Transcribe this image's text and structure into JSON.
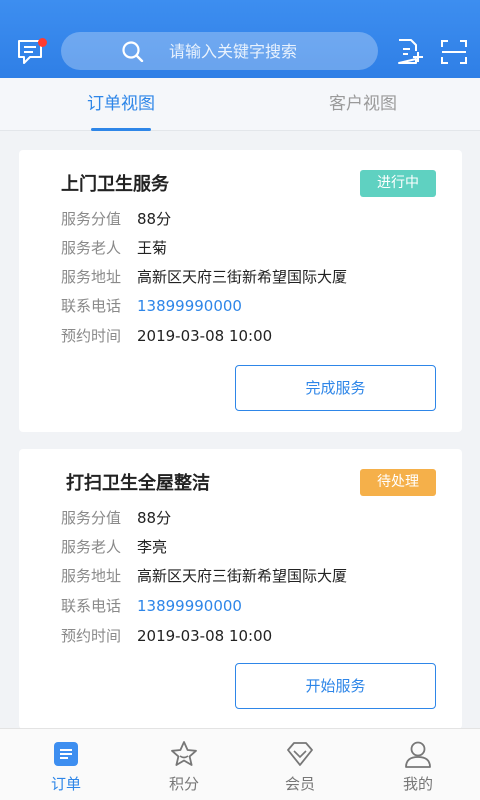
{
  "header": {
    "search_placeholder": "请输入关键字搜索",
    "icons": [
      "message-icon",
      "search-icon",
      "add-document-icon",
      "scan-icon"
    ],
    "accent": "#2e86e8"
  },
  "tabs": [
    {
      "label": "订单视图",
      "active": true
    },
    {
      "label": "客户视图",
      "active": false
    }
  ],
  "orders": [
    {
      "title": "上门卫生服务",
      "status": "进行中",
      "status_color": "#5fd1c1",
      "fields": [
        {
          "label": "服务分值",
          "value": "88分"
        },
        {
          "label": "服务老人",
          "value": "王菊"
        },
        {
          "label": "服务地址",
          "value": "高新区天府三街新希望国际大厦"
        },
        {
          "label": "联系电话",
          "value": "13899990000"
        },
        {
          "label": "预约时间",
          "value": "2019-03-08 10:00"
        }
      ],
      "action": "完成服务"
    },
    {
      "title": "打扫卫生全屋整洁",
      "status": "待处理",
      "status_color": "#f5b04a",
      "fields": [
        {
          "label": "服务分值",
          "value": "88分"
        },
        {
          "label": "服务老人",
          "value": "李亮"
        },
        {
          "label": "服务地址",
          "value": "高新区天府三街新希望国际大厦"
        },
        {
          "label": "联系电话",
          "value": "13899990000"
        },
        {
          "label": "预约时间",
          "value": "2019-03-08 10:00"
        }
      ],
      "action": "开始服务"
    }
  ],
  "bottom_nav": [
    {
      "label": "订单",
      "icon": "orders-icon",
      "active": true
    },
    {
      "label": "积分",
      "icon": "star-icon",
      "active": false
    },
    {
      "label": "会员",
      "icon": "diamond-icon",
      "active": false
    },
    {
      "label": "我的",
      "icon": "user-icon",
      "active": false
    }
  ]
}
